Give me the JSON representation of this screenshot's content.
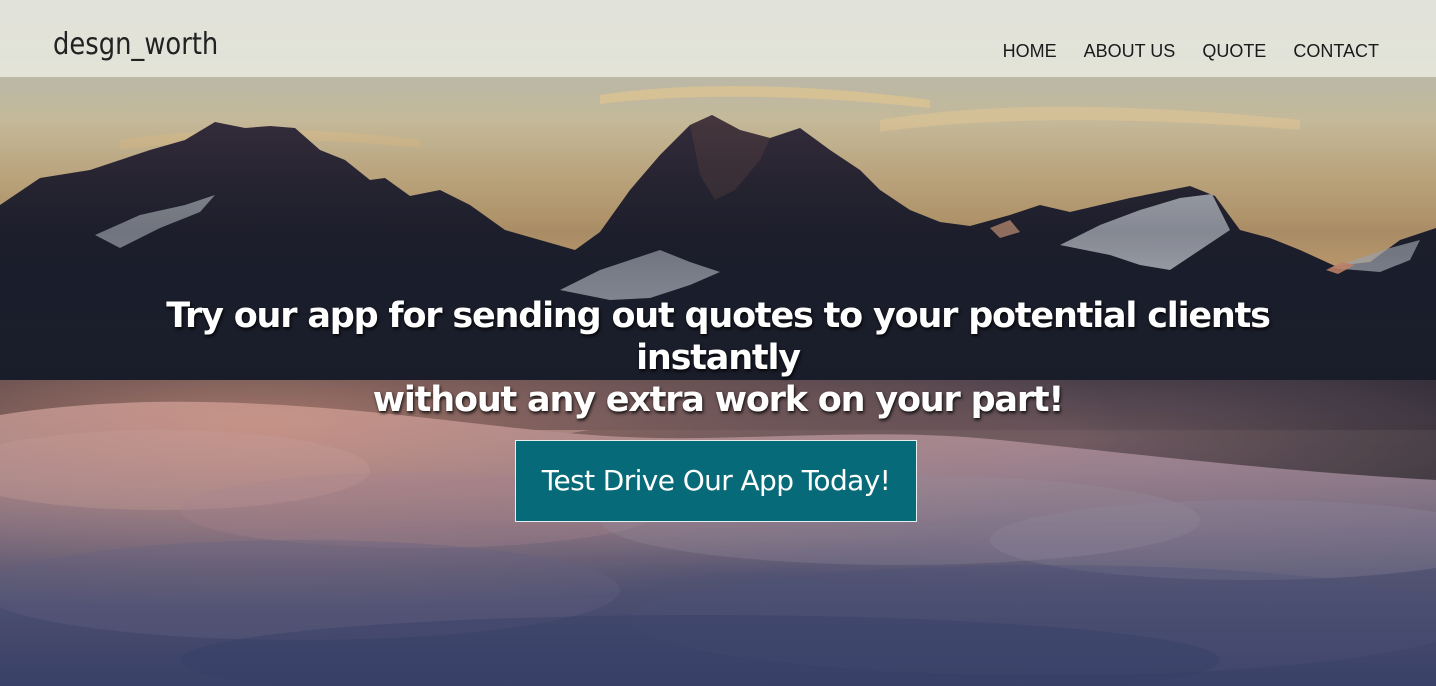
{
  "brand": {
    "logo_text": "desgn_worth"
  },
  "nav": {
    "items": [
      {
        "label": "HOME"
      },
      {
        "label": "ABOUT US"
      },
      {
        "label": "QUOTE"
      },
      {
        "label": "CONTACT"
      }
    ]
  },
  "hero": {
    "headline_line1": "Try our app for sending out quotes to your potential clients instantly",
    "headline_line2": "without any extra work on your part!",
    "cta_label": "Test Drive Our App Today!"
  },
  "colors": {
    "cta_background": "#076a78",
    "navbar_background": "#e8e8de",
    "headline_text": "#ffffff"
  }
}
